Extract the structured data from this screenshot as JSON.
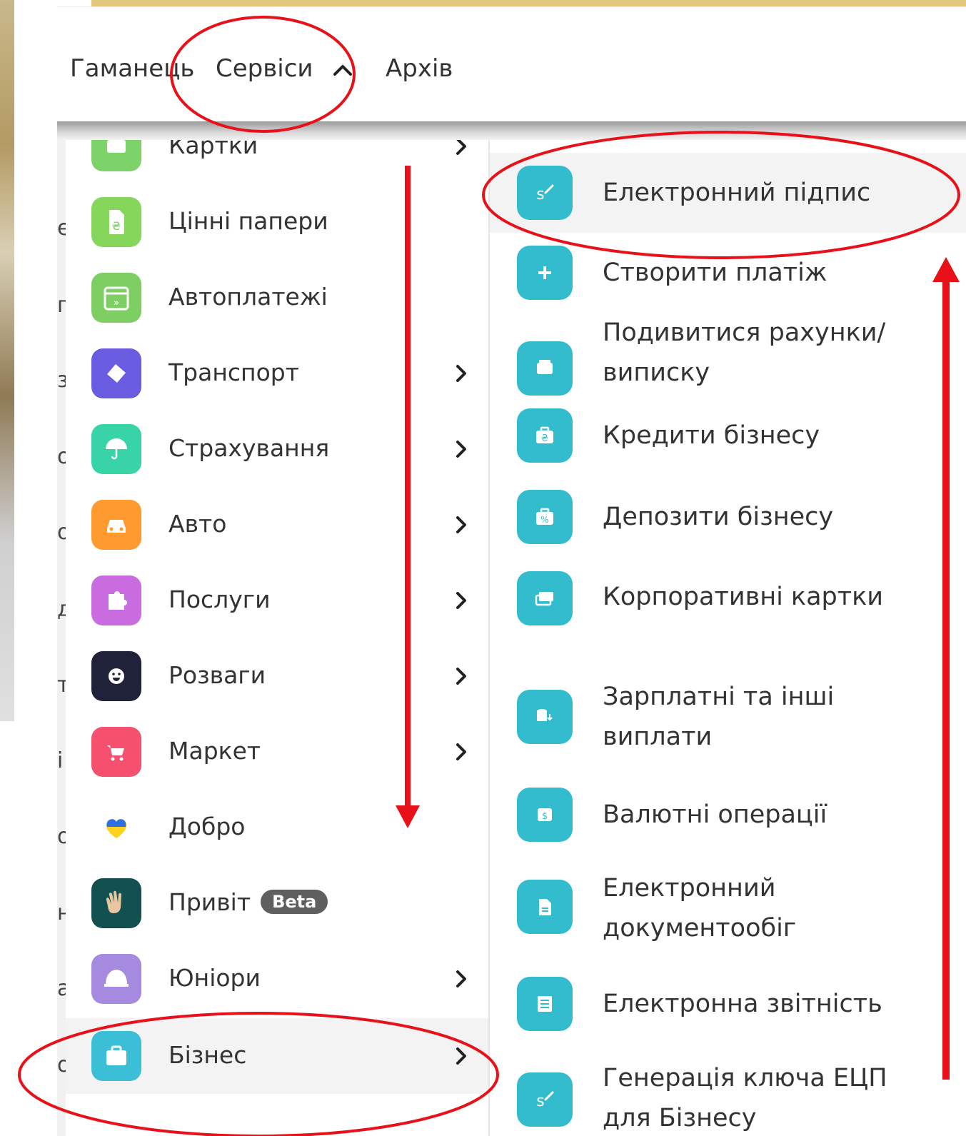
{
  "topnav": {
    "wallet": "Гаманець",
    "services": "Сервіси",
    "archive": "Архів"
  },
  "background_letters": [
    "е",
    "г",
    "з",
    "о",
    "о",
    "д",
    "т",
    "і",
    "о",
    "н",
    "а",
    "о"
  ],
  "left_menu": [
    {
      "label": "Картки",
      "icon": "card-icon",
      "color": "#7dd36a",
      "chevron": true
    },
    {
      "label": "Цінні папери",
      "icon": "securities-icon",
      "color": "#86d65c",
      "chevron": false
    },
    {
      "label": "Автоплатежі",
      "icon": "calendar-autopay-icon",
      "color": "#7dcf64",
      "chevron": false
    },
    {
      "label": "Транспорт",
      "icon": "ticket-icon",
      "color": "#6a5ce0",
      "chevron": true
    },
    {
      "label": "Страхування",
      "icon": "umbrella-icon",
      "color": "#38d4a8",
      "chevron": true
    },
    {
      "label": "Авто",
      "icon": "car-icon",
      "color": "#ff9a2e",
      "chevron": true
    },
    {
      "label": "Послуги",
      "icon": "puzzle-icon",
      "color": "#c86ce0",
      "chevron": true
    },
    {
      "label": "Розваги",
      "icon": "smile-icon",
      "color": "#1f2238",
      "chevron": true
    },
    {
      "label": "Маркет",
      "icon": "cart-icon",
      "color": "#f5506e",
      "chevron": true
    },
    {
      "label": "Добро",
      "icon": "heart-icon",
      "color": "transparent",
      "chevron": false
    },
    {
      "label": "Привіт",
      "icon": "hand-wave-icon",
      "color": "#12514f",
      "chevron": false,
      "badge": "Beta"
    },
    {
      "label": "Юніори",
      "icon": "cap-icon",
      "color": "#a58ae0",
      "chevron": true
    },
    {
      "label": "Бізнес",
      "icon": "briefcase-icon",
      "color": "#3bbfd6",
      "chevron": true,
      "active": true
    }
  ],
  "right_menu": [
    {
      "label": "Електронний підпис",
      "icon": "signature-icon",
      "active": true
    },
    {
      "label": "Створити платіж",
      "icon": "plus-icon"
    },
    {
      "label": "Подивитися рахунки/ виписку",
      "icon": "inbox-icon"
    },
    {
      "label": "Кредити бізнесу",
      "icon": "briefcase-hryvnia-icon"
    },
    {
      "label": "Депозити бізнесу",
      "icon": "briefcase-percent-icon"
    },
    {
      "label": "Корпоративні картки",
      "icon": "cards-icon"
    },
    {
      "label": "Зарплатні та інші виплати",
      "icon": "coins-icon"
    },
    {
      "label": "Валютні операції",
      "icon": "dollar-icon"
    },
    {
      "label": "Електронний документообіг",
      "icon": "document-icon"
    },
    {
      "label": "Електронна звітність",
      "icon": "report-icon"
    },
    {
      "label": "Генерація ключа ЕЦП для Бізнесу",
      "icon": "key-signature-icon"
    }
  ],
  "colors": {
    "accent_teal": "#33bccd",
    "annotation_red": "#e8111a",
    "header_gold": "#e2c77d"
  }
}
